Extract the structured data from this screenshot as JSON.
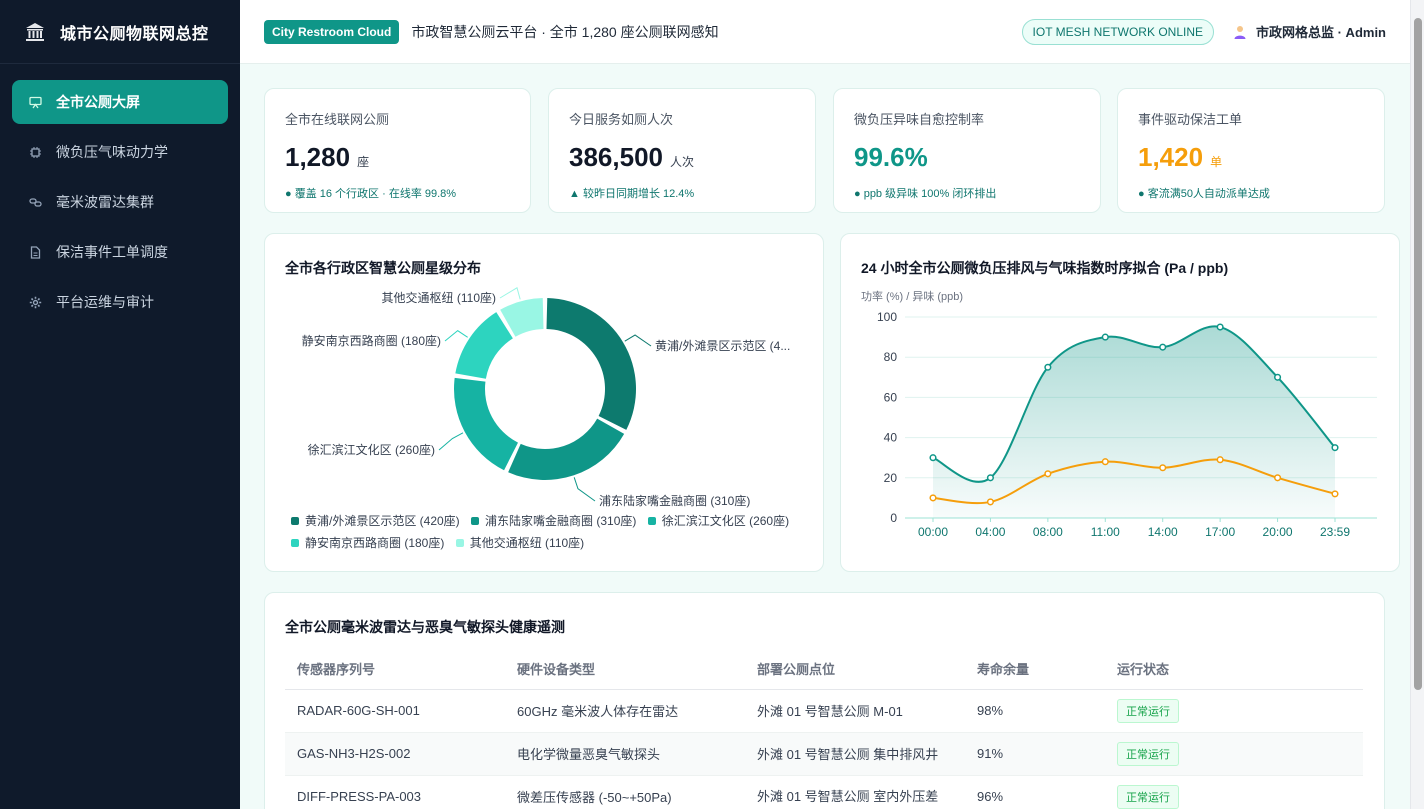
{
  "sidebar": {
    "brand_title": "城市公厕物联网总控",
    "items": [
      {
        "label": "全市公厕大屏",
        "icon": "monitor-icon",
        "active": true
      },
      {
        "label": "微负压气味动力学",
        "icon": "chip-icon",
        "active": false
      },
      {
        "label": "毫米波雷达集群",
        "icon": "link-icon",
        "active": false
      },
      {
        "label": "保洁事件工单调度",
        "icon": "document-icon",
        "active": false
      },
      {
        "label": "平台运维与审计",
        "icon": "gear-icon",
        "active": false
      }
    ]
  },
  "header": {
    "tag": "City Restroom Cloud",
    "subtitle": "市政智慧公厕云平台 · 全市 1,280 座公厕联网感知",
    "status": "IOT MESH NETWORK ONLINE",
    "user": "市政网格总监 · Admin"
  },
  "kpis": [
    {
      "label": "全市在线联网公厕",
      "value": "1,280",
      "unit": "座",
      "note": "● 覆盖 16 个行政区 · 在线率 99.8%",
      "color": "#111827"
    },
    {
      "label": "今日服务如厕人次",
      "value": "386,500",
      "unit": "人次",
      "note": "▲ 较昨日同期增长 12.4%",
      "color": "#111827"
    },
    {
      "label": "微负压异味自愈控制率",
      "value": "99.6%",
      "unit": "",
      "note": "● ppb 级异味 100% 闭环排出",
      "color": "#0f9688"
    },
    {
      "label": "事件驱动保洁工单",
      "value": "1,420",
      "unit": "单",
      "note": "● 客流满50人自动派单达成",
      "color": "#f59e0b"
    }
  ],
  "donut": {
    "title": "全市各行政区智慧公厕星级分布",
    "chart_data": {
      "type": "pie",
      "categories": [
        "黄浦/外滩景区示范区",
        "浦东陆家嘴金融商圈",
        "徐汇滨江文化区",
        "静安南京西路商圈",
        "其他交通枢纽"
      ],
      "values": [
        420,
        310,
        260,
        180,
        110
      ],
      "labels": [
        "黄浦/外滩景区示范区 (4...",
        "浦东陆家嘴金融商圈 (310座)",
        "徐汇滨江文化区 (260座)",
        "静安南京西路商圈 (180座)",
        "其他交通枢纽 (110座)"
      ],
      "legend": [
        "黄浦/外滩景区示范区 (420座)",
        "浦东陆家嘴金融商圈 (310座)",
        "徐汇滨江文化区 (260座)",
        "静安南京西路商圈 (180座)",
        "其他交通枢纽 (110座)"
      ],
      "colors": [
        "#0d7a6e",
        "#0f9688",
        "#16b3a3",
        "#2dd4bf",
        "#99f6e4"
      ],
      "legend_placement": "bottom"
    }
  },
  "line": {
    "title": "24 小时全市公厕微负压排风与气味指数时序拟合 (Pa / ppb)",
    "chart_data": {
      "type": "line",
      "x": [
        "00:00",
        "04:00",
        "08:00",
        "11:00",
        "14:00",
        "17:00",
        "20:00",
        "23:59"
      ],
      "ylabel": "功率 (%) / 异味 (ppb)",
      "ylim": [
        0,
        100
      ],
      "yticks": [
        "0",
        "20",
        "40",
        "60",
        "80",
        "100"
      ],
      "grid": true,
      "series": [
        {
          "values": [
            30,
            20,
            75,
            90,
            85,
            95,
            70,
            35
          ],
          "color": "#0f9688",
          "area": true
        },
        {
          "values": [
            10,
            8,
            22,
            28,
            25,
            29,
            20,
            12
          ],
          "color": "#f59e0b",
          "area": false
        }
      ]
    }
  },
  "table": {
    "title": "全市公厕毫米波雷达与恶臭气敏探头健康遥测",
    "columns": [
      "传感器序列号",
      "硬件设备类型",
      "部署公厕点位",
      "寿命余量",
      "运行状态"
    ],
    "rows": [
      [
        "RADAR-60G-SH-001",
        "60GHz 毫米波人体存在雷达",
        "外滩 01 号智慧公厕 M-01",
        "98%",
        "正常运行"
      ],
      [
        "GAS-NH3-H2S-002",
        "电化学微量恶臭气敏探头",
        "外滩 01 号智慧公厕 集中排风井",
        "91%",
        "正常运行"
      ],
      [
        "DIFF-PRESS-PA-003",
        "微差压传感器 (-50~+50Pa)",
        "外滩 01 号智慧公厕 室内外压差",
        "96%",
        "正常运行"
      ]
    ]
  }
}
